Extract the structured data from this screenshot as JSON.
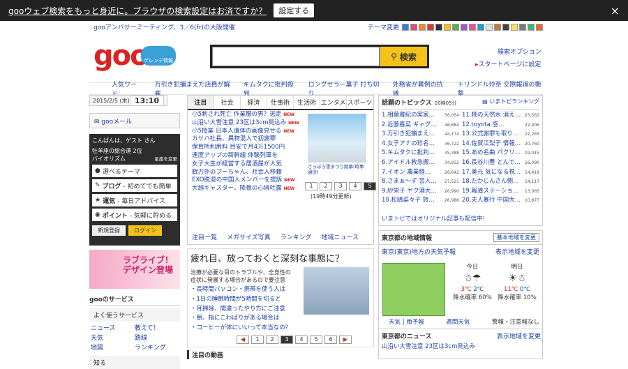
{
  "topbar": {
    "message": "gooウェブ検索をもっと身近に。ブラウザの検索設定はお済ですか？",
    "button": "設定する",
    "close": "×"
  },
  "header": {
    "promo": "gooアンバサーミーティング、3／6(fr)の大阪開催",
    "theme_label": "テーマ変更",
    "logo": "goo",
    "badge": "ゲレンデ情報",
    "search_placeholder": "",
    "search_button": "検索",
    "search_options": "検索オプション",
    "startpage": "スタートページに設定"
  },
  "trend": {
    "label": "人気ワード:",
    "items": [
      "万引き犯捕まえた店員が解雇",
      "キムタクに批判殺到",
      "ロングセラー菓子 打ち切り",
      "外務省が異例の抗議",
      "トリンドル玲奈 交際報道の衝撃"
    ]
  },
  "left": {
    "date": "2015/2/5 (木)",
    "time": "13:10",
    "mail": "gooメール",
    "greeting": "こんばんは、ゲスト さん",
    "horoscope": "牡羊座の総合運 2位",
    "horoscope2": "バイオリズム",
    "horoscope_link": "星座を変更",
    "select_theme": "選べるテーマ",
    "widgets": [
      {
        "name": "ブログ",
        "desc": " - 初めてでも簡単"
      },
      {
        "name": "運気",
        "desc": " - 毎日アドバイス"
      },
      {
        "name": "ポイント",
        "desc": " - 気軽に貯める"
      }
    ],
    "register": "新規登録",
    "login": "ログイン",
    "banner_line1": "ラブライブ！",
    "banner_line2": "デザイン登場",
    "services_title": "gooのサービス",
    "services_sub": "よく使うサービス",
    "services": [
      "ニュース",
      "教えて！",
      "天気",
      "路線",
      "地図",
      "ランキング"
    ],
    "more": "知る"
  },
  "news": {
    "tabs": [
      "注目",
      "社会",
      "経済",
      "仕事術",
      "生活術",
      "エンタメ",
      "スポーツ"
    ],
    "items": [
      "小5刺され死亡 作業服の男？逃走",
      "山沿い大雪注意 23区は3cm見込み",
      "小5授業 日本人遺体の画像見せる",
      "カサハ社長、異物混入で初謝罪",
      "保育所利用料 目安で月4万1500円",
      "速度アップの新幹線 体験列車を",
      "女子大生が経営する居酒屋が人気",
      "戦力外のプーちゃん、社会人移籍",
      "EXO脱退の中国人メンバーを提訴",
      "大越キャスター、降板の心境吐露"
    ],
    "photo_caption": "さっぽろ雪まつり開幕(時事通信)",
    "pages": [
      "1",
      "2",
      "3",
      "4",
      "5"
    ],
    "updated": "(19時49分更新)",
    "links": [
      "注目一覧",
      "メガサイズ写真",
      "ランキング",
      "地域ニュース"
    ]
  },
  "article": {
    "title": "疲れ目、放っておくと深刻な事態に？",
    "desc": "治療が必要な目のトラブルや、全身性の症状に発展する場合があるので要注意",
    "items": [
      "長時間パソコン・携帯を使う人は",
      "1日の睡眠時間が5時間を切ると",
      "耳掃除、間違ったやり方にご注意",
      "朝、指にこわばりがある場合は",
      "コーヒーが体にいいって本当なの？"
    ],
    "pages": [
      "◀",
      "1",
      "2",
      "3",
      "4",
      "5",
      "6",
      "▶"
    ],
    "bottom": "注目の動画"
  },
  "topics": {
    "title": "話題のトピックス",
    "time": "20時05分",
    "ranking": "いまトピランキング",
    "left": [
      [
        "1.",
        "相葉雅紀の実家…",
        "56,054"
      ],
      [
        "2.",
        "近藤春菜 ギャグ…",
        "46,884"
      ],
      [
        "3.",
        "万引き犯捕まえ…",
        "44,174"
      ],
      [
        "4.",
        "女子アナの珍名…",
        "36,722"
      ],
      [
        "5.",
        "キムタクに批判…",
        "35,388"
      ],
      [
        "6.",
        "アイドル救急搬…",
        "34,932"
      ],
      [
        "7.",
        "イオン 農業経…",
        "28,642"
      ],
      [
        "8.",
        "さまぁ～ず 芸人…",
        "27,521"
      ],
      [
        "9.",
        "紗栄子 ヤク酒大…",
        "26,990"
      ],
      [
        "10.",
        "松嶋菜々子 旅…",
        "26,986"
      ]
    ],
    "right": [
      [
        "11.",
        "桃の天然水 消え…",
        "23,562"
      ],
      [
        "12.",
        "toyota 感…",
        "22,406"
      ],
      [
        "13.",
        "公式謝罪も取り…",
        "22,265"
      ],
      [
        "14.",
        "佐賀江梨子 情報…",
        "20,760"
      ],
      [
        "15.",
        "あの名曲 パクリ…",
        "19,015"
      ],
      [
        "16.",
        "長谷川豊 とんで…",
        "16,090"
      ],
      [
        "17.",
        "美元 気になる視…",
        "14,419"
      ],
      [
        "18.",
        "たかじんさん側…",
        "14,117"
      ],
      [
        "19.",
        "報道ステーショ…",
        "13,065"
      ],
      [
        "20.",
        "夫人暴行 中国大…",
        "10,877"
      ]
    ],
    "footer": "いまトピではオリジナル記事も配信中！"
  },
  "regional": {
    "title": "東京都の地域情報",
    "change": "基本地域を変更",
    "weather_title": "東京(東京)地方の天気予報",
    "weather_link": "表示地域を変更",
    "today": {
      "label": "今日",
      "icon": "☃☂",
      "temp_hi": "3℃",
      "temp_lo": "2℃",
      "rain": "降水確率 60%"
    },
    "tomorrow": {
      "label": "明日",
      "icon": "☀☃",
      "temp_hi": "11℃",
      "temp_lo": "0℃",
      "rain": "降水確率 10%"
    },
    "foot": [
      "天気 | 雨予報",
      "週間天気",
      "警報・注意報なし"
    ],
    "news_title": "東京都のニュース",
    "news_link": "表示地域を変更",
    "news_item": "山沿い大雪注意 23区は3cm見込み"
  },
  "colors": {
    "accent": "#f6c21a",
    "link": "#1a3fa6",
    "logo": "#dd2222",
    "topbar": "#222222"
  }
}
